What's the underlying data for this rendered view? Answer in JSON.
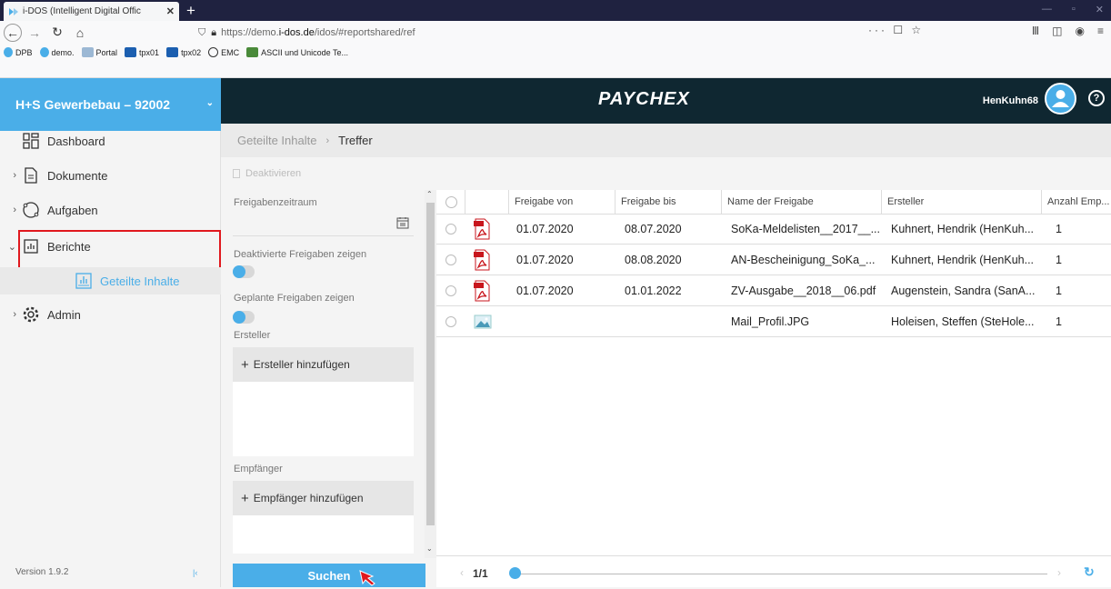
{
  "browser": {
    "tab_title": "i-DOS (Intelligent Digital Offic",
    "url_prefix": "https://demo.",
    "url_domain": "i-dos.de",
    "url_path": "/idos/#reportshared/ref",
    "bookmarks": [
      "DPB",
      "demo.",
      "Portal",
      "tpx01",
      "tpx02",
      "EMC",
      "ASCII und Unicode Te..."
    ]
  },
  "sidebar": {
    "company": "H+S Gewerbebau – 92002",
    "items": [
      {
        "label": "Dashboard"
      },
      {
        "label": "Dokumente"
      },
      {
        "label": "Aufgaben"
      },
      {
        "label": "Berichte"
      },
      {
        "label": "Geteilte Inhalte"
      },
      {
        "label": "Admin"
      }
    ],
    "version": "Version 1.9.2"
  },
  "header": {
    "logo": "PAYCHEX",
    "user": "HenKuhn68",
    "help": "?"
  },
  "breadcrumb": {
    "root": "Geteilte Inhalte",
    "current": "Treffer"
  },
  "toolbar": {
    "deactivate": "Deaktivieren"
  },
  "filter": {
    "period_label": "Freigabenzeitraum",
    "show_deactivated": "Deaktivierte Freigaben zeigen",
    "show_planned": "Geplante Freigaben zeigen",
    "creator_label": "Ersteller",
    "add_creator": "Ersteller hinzufügen",
    "recipient_label": "Empfänger",
    "add_recipient": "Empfänger hinzufügen",
    "search_button": "Suchen"
  },
  "table": {
    "columns": [
      "Freigabe von",
      "Freigabe bis",
      "Name der Freigabe",
      "Ersteller",
      "Anzahl Emp..."
    ],
    "rows": [
      {
        "type": "pdf",
        "von": "01.07.2020",
        "bis": "08.07.2020",
        "name": "SoKa-Meldelisten__2017__...",
        "ersteller": "Kuhnert, Hendrik (HenKuh...",
        "anzahl": "1"
      },
      {
        "type": "pdf",
        "von": "01.07.2020",
        "bis": "08.08.2020",
        "name": "AN-Bescheinigung_SoKa_...",
        "ersteller": "Kuhnert, Hendrik (HenKuh...",
        "anzahl": "1"
      },
      {
        "type": "pdf",
        "von": "01.07.2020",
        "bis": "01.01.2022",
        "name": "ZV-Ausgabe__2018__06.pdf",
        "ersteller": "Augenstein, Sandra (SanA...",
        "anzahl": "1"
      },
      {
        "type": "image",
        "von": "",
        "bis": "",
        "name": "Mail_Profil.JPG",
        "ersteller": "Holeisen, Steffen (SteHole...",
        "anzahl": "1"
      }
    ]
  },
  "pager": {
    "text": "1/1"
  },
  "colors": {
    "accent": "#4aaee8",
    "header_bg": "#0f2731",
    "highlight": "#e0181e"
  }
}
